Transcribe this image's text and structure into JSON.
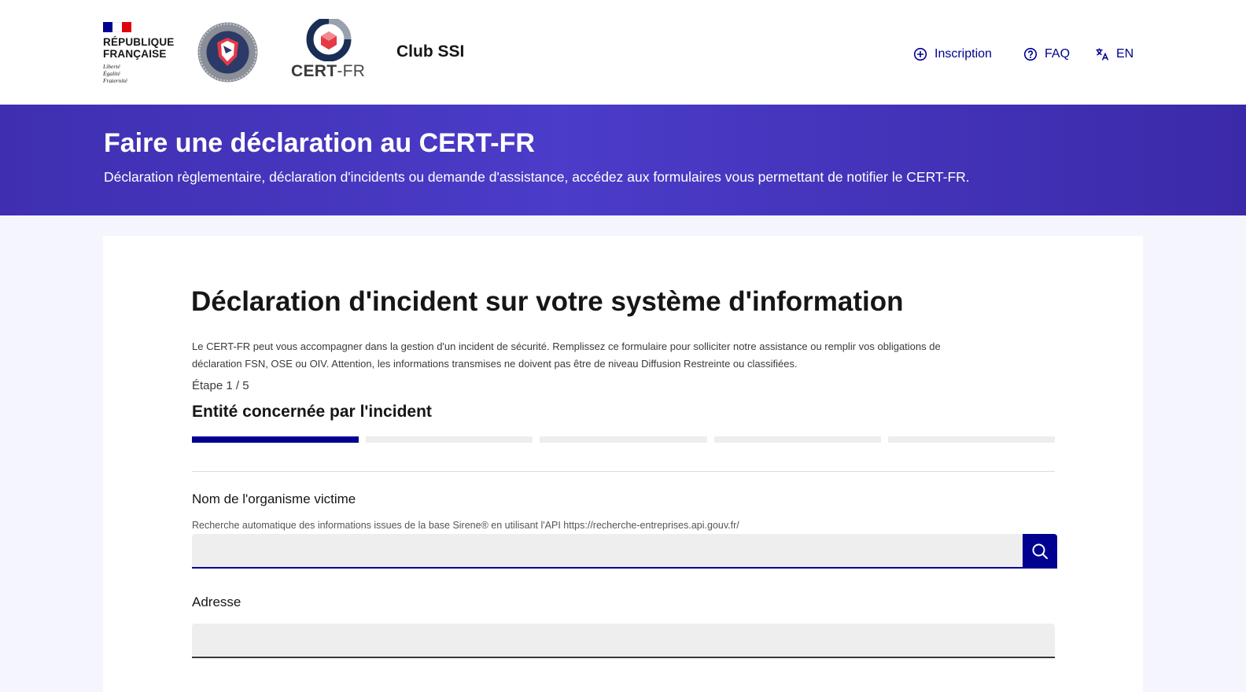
{
  "header": {
    "rf_logo": {
      "line1": "RÉPUBLIQUE",
      "line2": "FRANÇAISE",
      "motto1": "Liberté",
      "motto2": "Égalité",
      "motto3": "Fraternité"
    },
    "cert_logo": {
      "bold": "CERT",
      "light": "-FR"
    },
    "site_name": "Club SSI",
    "nav": {
      "inscription": "Inscription",
      "faq": "FAQ",
      "lang": "EN"
    },
    "icons": {
      "inscription": "plus-circle-icon",
      "faq": "question-circle-icon",
      "lang": "translate-icon"
    }
  },
  "banner": {
    "title": "Faire une déclaration au CERT-FR",
    "subtitle": "Déclaration règlementaire, déclaration d'incidents ou demande d'assistance, accédez aux formulaires vous permettant de notifier le CERT-FR."
  },
  "form": {
    "title": "Déclaration d'incident sur votre système d'information",
    "intro_line1": "Le CERT-FR peut vous accompagner dans la gestion d'un incident de sécurité. Remplissez ce formulaire pour solliciter notre assistance ou remplir vos obligations de",
    "intro_line2": "déclaration FSN, OSE ou OIV. Attention, les informations transmises ne doivent pas être de niveau Diffusion Restreinte ou classifiées.",
    "step_counter": "Étape 1 / 5",
    "step_title": "Entité concernée par l'incident",
    "steps_total": 5,
    "current_step": 1,
    "fields": {
      "org_name": {
        "label": "Nom de l'organisme victime",
        "hint": "Recherche automatique des informations issues de la base Sirene® en utilisant l'API https://recherche-entreprises.api.gouv.fr/",
        "value": ""
      },
      "address": {
        "label": "Adresse",
        "value": ""
      }
    }
  },
  "colors": {
    "primary": "#000091",
    "banner_start": "#3f2fb0",
    "banner_mid": "#4b3cc9",
    "page_bg": "#f5f5fe",
    "flag_blue": "#000091",
    "flag_red": "#e1000f"
  }
}
